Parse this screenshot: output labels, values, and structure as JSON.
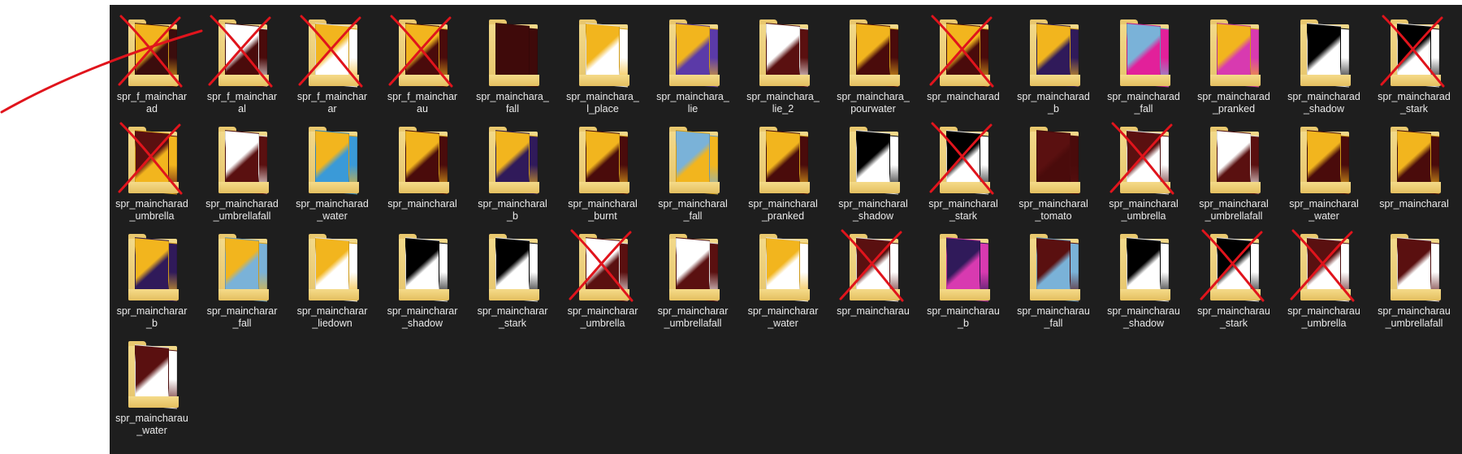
{
  "window": {
    "background": "#1e1e1e",
    "label_color": "#eaeaea"
  },
  "annotation": {
    "color": "#e0141c",
    "meaning": "red-x-cross-out"
  },
  "folders": [
    {
      "name": "spr_f_mainchar\nad",
      "thumb": [
        "#f2b51e",
        "#3b0d0d"
      ],
      "crossed": true
    },
    {
      "name": "spr_f_mainchar\nal",
      "thumb": [
        "#ffffff",
        "#4a0b0b"
      ],
      "crossed": true
    },
    {
      "name": "spr_f_mainchar\nar",
      "thumb": [
        "#f2b51e",
        "#ffffff"
      ],
      "crossed": true
    },
    {
      "name": "spr_f_mainchar\nau",
      "thumb": [
        "#f2b51e",
        "#4a0b0b"
      ],
      "crossed": true
    },
    {
      "name": "spr_mainchara_\nfall",
      "thumb": [
        "#3f0a0a",
        "#3f0a0a"
      ],
      "crossed": false
    },
    {
      "name": "spr_mainchara_\nl_place",
      "thumb": [
        "#f2b51e",
        "#ffffff"
      ],
      "crossed": false
    },
    {
      "name": "spr_mainchara_\nlie",
      "thumb": [
        "#f2b51e",
        "#5b3aa8"
      ],
      "crossed": false
    },
    {
      "name": "spr_mainchara_\nlie_2",
      "thumb": [
        "#ffffff",
        "#5a1010"
      ],
      "crossed": false
    },
    {
      "name": "spr_mainchara_\npourwater",
      "thumb": [
        "#f2b51e",
        "#4a0b0b"
      ],
      "crossed": false
    },
    {
      "name": "spr_maincharad",
      "thumb": [
        "#f2b51e",
        "#4a0b0b"
      ],
      "crossed": true
    },
    {
      "name": "spr_maincharad\n_b",
      "thumb": [
        "#f2b51e",
        "#301a5a"
      ],
      "crossed": false
    },
    {
      "name": "spr_maincharad\n_fall",
      "thumb": [
        "#7ab2d8",
        "#e2209a"
      ],
      "crossed": false
    },
    {
      "name": "spr_maincharad\n_pranked",
      "thumb": [
        "#f2b51e",
        "#d83ab0"
      ],
      "crossed": false
    },
    {
      "name": "spr_maincharad\n_shadow",
      "thumb": [
        "#000000",
        "#ffffff"
      ],
      "crossed": false
    },
    {
      "name": "spr_maincharad\n_stark",
      "thumb": [
        "#000000",
        "#ffffff"
      ],
      "crossed": true
    },
    {
      "name": "spr_maincharad\n_umbrella",
      "thumb": [
        "#5a1010",
        "#f2b51e"
      ],
      "crossed": true
    },
    {
      "name": "spr_maincharad\n_umbrellafall",
      "thumb": [
        "#ffffff",
        "#5a1010"
      ],
      "crossed": false
    },
    {
      "name": "spr_maincharad\n_water",
      "thumb": [
        "#f2b51e",
        "#3a9ad8"
      ],
      "crossed": false
    },
    {
      "name": "spr_maincharal",
      "thumb": [
        "#f2b51e",
        "#4a0b0b"
      ],
      "crossed": false
    },
    {
      "name": "spr_maincharal\n_b",
      "thumb": [
        "#f2b51e",
        "#301a5a"
      ],
      "crossed": false
    },
    {
      "name": "spr_maincharal\n_burnt",
      "thumb": [
        "#f2b51e",
        "#4a0b0b"
      ],
      "crossed": false
    },
    {
      "name": "spr_maincharal\n_fall",
      "thumb": [
        "#7ab2d8",
        "#f2b51e"
      ],
      "crossed": false
    },
    {
      "name": "spr_maincharal\n_pranked",
      "thumb": [
        "#f2b51e",
        "#4a0b0b"
      ],
      "crossed": false
    },
    {
      "name": "spr_maincharal\n_shadow",
      "thumb": [
        "#000000",
        "#ffffff"
      ],
      "crossed": false
    },
    {
      "name": "spr_maincharal\n_stark",
      "thumb": [
        "#000000",
        "#ffffff"
      ],
      "crossed": true
    },
    {
      "name": "spr_maincharal\n_tomato",
      "thumb": [
        "#5a1010",
        "#4a0b0b"
      ],
      "crossed": false
    },
    {
      "name": "spr_maincharal\n_umbrella",
      "thumb": [
        "#5a1010",
        "#ffffff"
      ],
      "crossed": true
    },
    {
      "name": "spr_maincharal\n_umbrellafall",
      "thumb": [
        "#ffffff",
        "#5a1010"
      ],
      "crossed": false
    },
    {
      "name": "spr_maincharal\n_water",
      "thumb": [
        "#f2b51e",
        "#4a0b0b"
      ],
      "crossed": false
    },
    {
      "name": "spr_maincharal",
      "thumb": [
        "#f2b51e",
        "#4a0b0b"
      ],
      "crossed": false
    },
    {
      "name": "spr_maincharar\n_b",
      "thumb": [
        "#f2b51e",
        "#301a5a"
      ],
      "crossed": false
    },
    {
      "name": "spr_maincharar\n_fall",
      "thumb": [
        "#f2b51e",
        "#7ab2d8"
      ],
      "crossed": false
    },
    {
      "name": "spr_maincharar\n_liedown",
      "thumb": [
        "#f2b51e",
        "#ffffff"
      ],
      "crossed": false
    },
    {
      "name": "spr_maincharar\n_shadow",
      "thumb": [
        "#000000",
        "#ffffff"
      ],
      "crossed": false
    },
    {
      "name": "spr_maincharar\n_stark",
      "thumb": [
        "#000000",
        "#ffffff"
      ],
      "crossed": false
    },
    {
      "name": "spr_maincharar\n_umbrella",
      "thumb": [
        "#ffffff",
        "#5a1010"
      ],
      "crossed": true
    },
    {
      "name": "spr_maincharar\n_umbrellafall",
      "thumb": [
        "#ffffff",
        "#5a1010"
      ],
      "crossed": false
    },
    {
      "name": "spr_maincharar\n_water",
      "thumb": [
        "#f2b51e",
        "#ffffff"
      ],
      "crossed": false
    },
    {
      "name": "spr_maincharau",
      "thumb": [
        "#5a1010",
        "#ffffff"
      ],
      "crossed": true
    },
    {
      "name": "spr_maincharau\n_b",
      "thumb": [
        "#301a5a",
        "#d83ab0"
      ],
      "crossed": false
    },
    {
      "name": "spr_maincharau\n_fall",
      "thumb": [
        "#5a1010",
        "#7ab2d8"
      ],
      "crossed": false
    },
    {
      "name": "spr_maincharau\n_shadow",
      "thumb": [
        "#000000",
        "#ffffff"
      ],
      "crossed": false
    },
    {
      "name": "spr_maincharau\n_stark",
      "thumb": [
        "#000000",
        "#ffffff"
      ],
      "crossed": true
    },
    {
      "name": "spr_maincharau\n_umbrella",
      "thumb": [
        "#5a1010",
        "#ffffff"
      ],
      "crossed": true
    },
    {
      "name": "spr_maincharau\n_umbrellafall",
      "thumb": [
        "#5a1010",
        "#ffffff"
      ],
      "crossed": false
    },
    {
      "name": "spr_maincharau\n_water",
      "thumb": [
        "#5a1010",
        "#ffffff"
      ],
      "crossed": false
    }
  ]
}
